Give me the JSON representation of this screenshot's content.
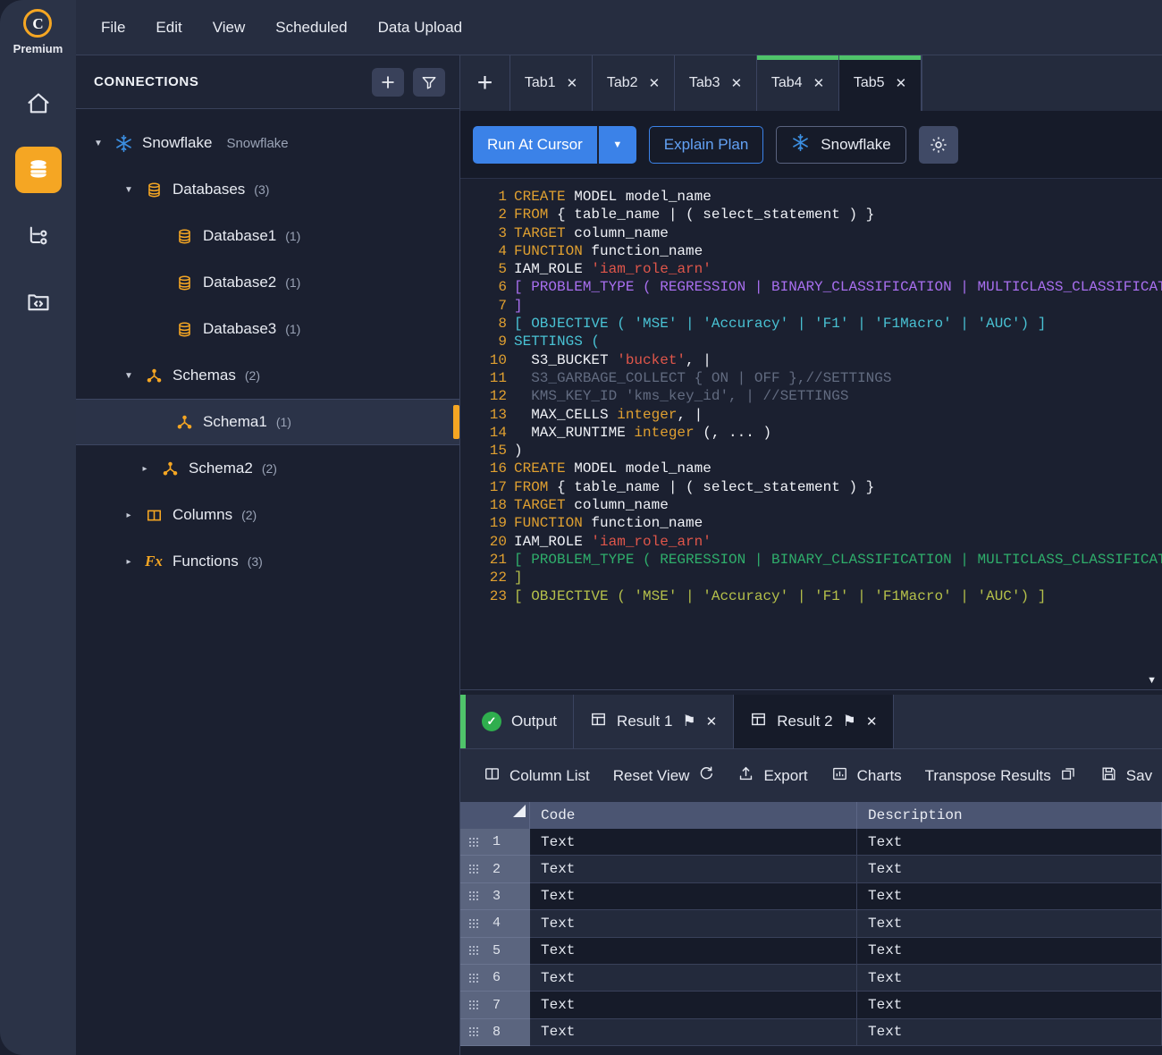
{
  "rail": {
    "brand": {
      "logo_letter": "C",
      "label": "Premium",
      "logo_color": "#f5a623"
    },
    "items": [
      {
        "name": "home-icon",
        "active": false
      },
      {
        "name": "database-icon",
        "active": true
      },
      {
        "name": "workflow-icon",
        "active": false
      },
      {
        "name": "code-folder-icon",
        "active": false
      }
    ]
  },
  "menubar": {
    "items": [
      "File",
      "Edit",
      "View",
      "Scheduled",
      "Data Upload"
    ]
  },
  "sidebar": {
    "title": "CONNECTIONS",
    "add_label": "+",
    "filter_label": "filter",
    "tree": [
      {
        "label": "Snowflake",
        "subtype": "Snowflake",
        "count": "",
        "icon": "snowflake-icon",
        "depth": 0,
        "caret": "down",
        "selected": false
      },
      {
        "label": "Databases",
        "subtype": "",
        "count": "(3)",
        "icon": "database-icon",
        "depth": 1,
        "caret": "down",
        "selected": false
      },
      {
        "label": "Database1",
        "subtype": "",
        "count": "(1)",
        "icon": "database-icon",
        "depth": 2,
        "caret": "none",
        "selected": false
      },
      {
        "label": "Database2",
        "subtype": "",
        "count": "(1)",
        "icon": "database-icon",
        "depth": 2,
        "caret": "none",
        "selected": false
      },
      {
        "label": "Database3",
        "subtype": "",
        "count": "(1)",
        "icon": "database-icon",
        "depth": 2,
        "caret": "none",
        "selected": false
      },
      {
        "label": "Schemas",
        "subtype": "",
        "count": "(2)",
        "icon": "schema-icon",
        "depth": 1,
        "caret": "down",
        "selected": false
      },
      {
        "label": "Schema1",
        "subtype": "",
        "count": "(1)",
        "icon": "schema-icon",
        "depth": 2,
        "caret": "none",
        "selected": true
      },
      {
        "label": "Schema2",
        "subtype": "",
        "count": "(2)",
        "icon": "schema-icon",
        "depth": 2,
        "caret": "right",
        "selected": false
      },
      {
        "label": "Columns",
        "subtype": "",
        "count": "(2)",
        "icon": "columns-icon",
        "depth": 1,
        "caret": "right",
        "selected": false
      },
      {
        "label": "Functions",
        "subtype": "",
        "count": "(3)",
        "icon": "function-icon",
        "depth": 1,
        "caret": "right",
        "selected": false
      }
    ]
  },
  "editor": {
    "add_tab_label": "+",
    "tabs": [
      {
        "label": "Tab1",
        "close": "✕",
        "active": false,
        "marked": false
      },
      {
        "label": "Tab2",
        "close": "✕",
        "active": false,
        "marked": false
      },
      {
        "label": "Tab3",
        "close": "✕",
        "active": false,
        "marked": false
      },
      {
        "label": "Tab4",
        "close": "✕",
        "active": false,
        "marked": true
      },
      {
        "label": "Tab5",
        "close": "✕",
        "active": true,
        "marked": true
      }
    ],
    "toolbar": {
      "run_label": "Run At Cursor",
      "run_caret": "▼",
      "explain_label": "Explain Plan",
      "connection_label": "Snowflake",
      "settings_label": "settings"
    },
    "code_lines": [
      {
        "n": "1",
        "tokens": [
          {
            "t": "CREATE",
            "c": "kw"
          },
          {
            "t": " MODEL model_name",
            "c": "white"
          }
        ]
      },
      {
        "n": "2",
        "tokens": [
          {
            "t": "FROM",
            "c": "kw"
          },
          {
            "t": " { table_name | ( select_statement ) }",
            "c": "white"
          }
        ]
      },
      {
        "n": "3",
        "tokens": [
          {
            "t": "TARGET",
            "c": "kw"
          },
          {
            "t": " column_name",
            "c": "white"
          }
        ]
      },
      {
        "n": "4",
        "tokens": [
          {
            "t": "FUNCTION",
            "c": "kw"
          },
          {
            "t": " function_name",
            "c": "white"
          }
        ]
      },
      {
        "n": "5",
        "tokens": [
          {
            "t": "IAM_ROLE ",
            "c": "white"
          },
          {
            "t": "'iam_role_arn'",
            "c": "str"
          }
        ]
      },
      {
        "n": "6",
        "tokens": [
          {
            "t": "[ PROBLEM_TYPE ( REGRESSION | BINARY_CLASSIFICATION | MULTICLASS_CLASSIFICATION ",
            "c": "purple"
          }
        ]
      },
      {
        "n": "7",
        "tokens": [
          {
            "t": "]",
            "c": "purple"
          }
        ]
      },
      {
        "n": "8",
        "tokens": [
          {
            "t": "[ OBJECTIVE ( 'MSE' | 'Accuracy' | 'F1' | 'F1Macro' | 'AUC') ]",
            "c": "cyan"
          }
        ]
      },
      {
        "n": "9",
        "tokens": [
          {
            "t": "SETTINGS (",
            "c": "cyan"
          }
        ]
      },
      {
        "n": "10",
        "tokens": [
          {
            "t": "  S3_BUCKET ",
            "c": "white"
          },
          {
            "t": "'bucket'",
            "c": "str"
          },
          {
            "t": ", |",
            "c": "white"
          }
        ]
      },
      {
        "n": "11",
        "tokens": [
          {
            "t": "  S3_GARBAGE_COLLECT { ON | OFF },//SETTINGS",
            "c": "dim"
          }
        ]
      },
      {
        "n": "12",
        "tokens": [
          {
            "t": "  KMS_KEY_ID 'kms_key_id', | //SETTINGS",
            "c": "dim"
          }
        ]
      },
      {
        "n": "13",
        "tokens": [
          {
            "t": "  MAX_CELLS ",
            "c": "white"
          },
          {
            "t": "integer",
            "c": "kw"
          },
          {
            "t": ", |",
            "c": "white"
          }
        ]
      },
      {
        "n": "14",
        "tokens": [
          {
            "t": "  MAX_RUNTIME ",
            "c": "white"
          },
          {
            "t": "integer",
            "c": "kw"
          },
          {
            "t": " (, ... )",
            "c": "white"
          }
        ]
      },
      {
        "n": "15",
        "tokens": [
          {
            "t": ")",
            "c": "white"
          }
        ]
      },
      {
        "n": "16",
        "tokens": [
          {
            "t": "CREATE",
            "c": "kw"
          },
          {
            "t": " MODEL model_name",
            "c": "white"
          }
        ]
      },
      {
        "n": "17",
        "tokens": [
          {
            "t": "FROM",
            "c": "kw"
          },
          {
            "t": " { table_name | ( select_statement ) }",
            "c": "white"
          }
        ]
      },
      {
        "n": "18",
        "tokens": [
          {
            "t": "TARGET",
            "c": "kw"
          },
          {
            "t": " column_name",
            "c": "white"
          }
        ]
      },
      {
        "n": "19",
        "tokens": [
          {
            "t": "FUNCTION",
            "c": "kw"
          },
          {
            "t": " function_name",
            "c": "white"
          }
        ]
      },
      {
        "n": "20",
        "tokens": [
          {
            "t": "IAM_ROLE ",
            "c": "white"
          },
          {
            "t": "'iam_role_arn'",
            "c": "str"
          }
        ]
      },
      {
        "n": "21",
        "tokens": [
          {
            "t": "[ PROBLEM_TYPE ( REGRESSION | BINARY_CLASSIFICATION | MULTICLASS_CLASSIFICATION ",
            "c": "green"
          }
        ]
      },
      {
        "n": "22",
        "tokens": [
          {
            "t": "]",
            "c": "olive"
          }
        ]
      },
      {
        "n": "23",
        "tokens": [
          {
            "t": "[ OBJECTIVE ( 'MSE' | 'Accuracy' | 'F1' | 'F1Macro' | 'AUC') ]",
            "c": "olive"
          }
        ]
      }
    ]
  },
  "results": {
    "tabs": [
      {
        "label": "Output",
        "icon": "success-check-icon",
        "active": false,
        "pinned": false,
        "closable": false
      },
      {
        "label": "Result 1",
        "icon": "table-icon",
        "active": false,
        "pinned": true,
        "closable": true,
        "pin_glyph": "⚑",
        "close_glyph": "✕"
      },
      {
        "label": "Result 2",
        "icon": "table-icon",
        "active": true,
        "pinned": true,
        "closable": true,
        "pin_glyph": "⚑",
        "close_glyph": "✕"
      }
    ],
    "toolbar": [
      {
        "label": "Column List",
        "icon": "columns-layout-icon"
      },
      {
        "label": "Reset View",
        "icon": "refresh-icon",
        "icon_after": true
      },
      {
        "label": "Export",
        "icon": "upload-icon"
      },
      {
        "label": "Charts",
        "icon": "chart-icon"
      },
      {
        "label": "Transpose Results",
        "icon": "transpose-icon",
        "icon_after": true
      },
      {
        "label": "Sav",
        "icon": "save-icon"
      }
    ],
    "grid": {
      "columns": [
        "Code",
        "Description"
      ],
      "rows": [
        {
          "n": "1",
          "cells": [
            "Text",
            "Text"
          ]
        },
        {
          "n": "2",
          "cells": [
            "Text",
            "Text"
          ]
        },
        {
          "n": "3",
          "cells": [
            "Text",
            "Text"
          ]
        },
        {
          "n": "4",
          "cells": [
            "Text",
            "Text"
          ]
        },
        {
          "n": "5",
          "cells": [
            "Text",
            "Text"
          ]
        },
        {
          "n": "6",
          "cells": [
            "Text",
            "Text"
          ]
        },
        {
          "n": "7",
          "cells": [
            "Text",
            "Text"
          ]
        },
        {
          "n": "8",
          "cells": [
            "Text",
            "Text"
          ]
        }
      ]
    }
  },
  "colors": {
    "accent_orange": "#f5a623",
    "accent_blue": "#3b82e8",
    "accent_green": "#4fc46a",
    "bg_dark": "#1b2030",
    "bg_panel": "#262d40"
  }
}
